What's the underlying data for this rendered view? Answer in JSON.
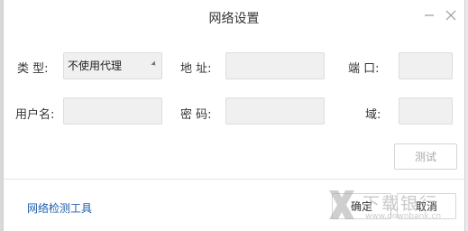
{
  "dialog": {
    "title": "网络设置",
    "minimize_icon": "minimize-icon",
    "close_icon": "close-icon"
  },
  "fields": {
    "type_label": "类  型:",
    "type_value": "不使用代理",
    "address_label": "地  址:",
    "address_value": "",
    "port_label": "端  口:",
    "port_value": "",
    "username_label": "用户名:",
    "username_value": "",
    "password_label": "密  码:",
    "password_value": "",
    "domain_label": "域:",
    "domain_value": ""
  },
  "buttons": {
    "test": "测试",
    "ok": "确定",
    "cancel": "取消"
  },
  "footer": {
    "network_check_link": "网络检测工具"
  },
  "watermark": {
    "brand": "下载银行",
    "url": "www.downbank.cn"
  },
  "colors": {
    "link": "#1f5fae",
    "field_bg": "#f0f0f0",
    "disabled_text": "#a8a8a8"
  }
}
